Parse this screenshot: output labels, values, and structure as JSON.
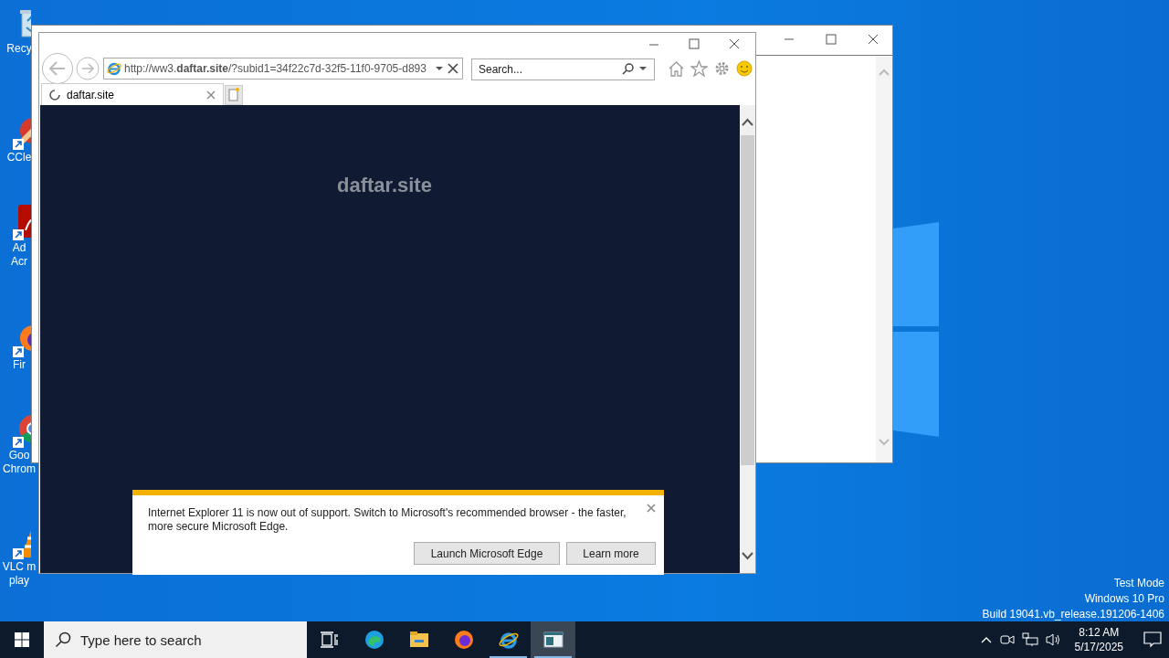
{
  "desktop_icons": [
    {
      "kind": "recycle",
      "lines": [
        "Recy"
      ]
    },
    {
      "kind": "ccleaner",
      "lines": [
        "CCle"
      ]
    },
    {
      "kind": "acrobat",
      "lines": [
        "Ad",
        "Acr"
      ]
    },
    {
      "kind": "firefox",
      "lines": [
        "Fir"
      ]
    },
    {
      "kind": "chrome",
      "lines": [
        "Goo",
        "Chrom"
      ]
    },
    {
      "kind": "vlc",
      "lines": [
        "VLC m",
        "play"
      ]
    }
  ],
  "browser": {
    "address": "http://ww3.**daftar.site**/?subid1=34f22c7d-32f5-11f0-9705-d893",
    "search": {
      "placeholder": "Search..."
    },
    "tabs": [
      {
        "label": "daftar.site",
        "selected": true,
        "loading": true
      }
    ],
    "page": {
      "heading": "daftar.site"
    },
    "notification": {
      "text": "Internet Explorer 11 is now out of support. Switch to Microsoft's recommended browser - the faster, more secure Microsoft Edge.",
      "buttons": [
        "Launch Microsoft Edge",
        "Learn more"
      ]
    }
  },
  "system_text": [
    "Test Mode",
    "Windows 10 Pro",
    "Build 19041.vb_release.191206-1406"
  ],
  "taskbar": {
    "search": {
      "placeholder": "Type here to search"
    },
    "apps": [
      {
        "kind": "taskview",
        "running": false,
        "selected": false
      },
      {
        "kind": "edge",
        "running": false,
        "selected": false
      },
      {
        "kind": "explorer",
        "running": false,
        "selected": false
      },
      {
        "kind": "firefox",
        "running": false,
        "selected": false
      },
      {
        "kind": "ie",
        "running": true,
        "selected": false
      },
      {
        "kind": "window",
        "running": true,
        "selected": true
      }
    ],
    "time": "8:12 AM",
    "date": "5/17/2025"
  }
}
